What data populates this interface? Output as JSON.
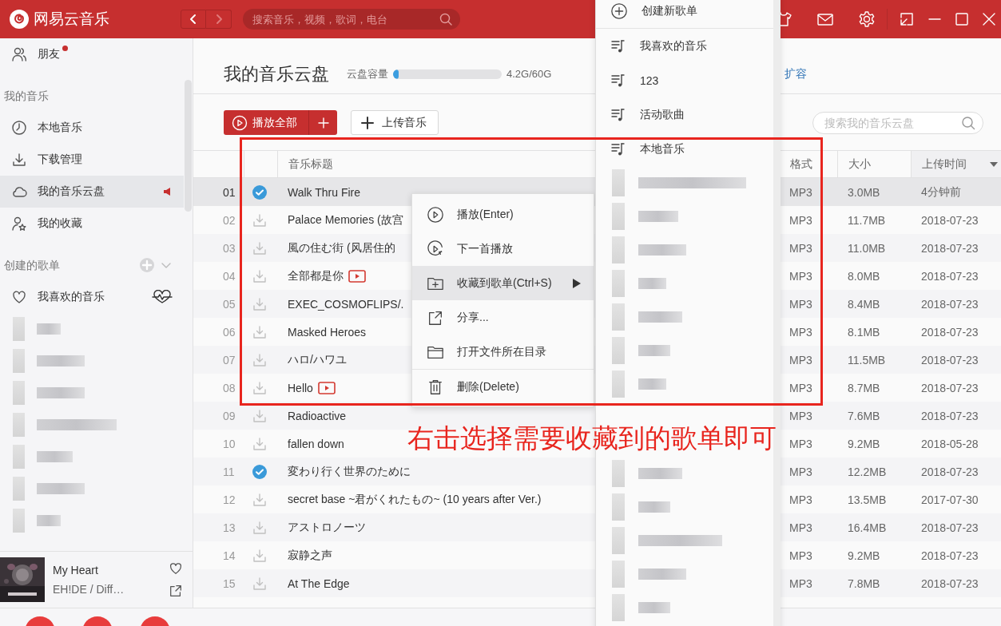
{
  "app": {
    "name": "网易云音乐"
  },
  "search": {
    "placeholder": "搜索音乐，视频，歌词，电台"
  },
  "sidebar": {
    "items": [
      {
        "kind": "item",
        "label": "朋友",
        "notify": true,
        "selected": false,
        "playing": false
      },
      {
        "kind": "section",
        "label": "我的音乐"
      },
      {
        "kind": "item",
        "label": "本地音乐",
        "notify": false,
        "selected": false,
        "playing": false
      },
      {
        "kind": "item",
        "label": "下载管理",
        "notify": false,
        "selected": false,
        "playing": false
      },
      {
        "kind": "item",
        "label": "我的音乐云盘",
        "notify": false,
        "selected": true,
        "playing": true
      },
      {
        "kind": "item",
        "label": "我的收藏",
        "notify": false,
        "selected": false,
        "playing": false
      },
      {
        "kind": "playlist_header",
        "label": "创建的歌单"
      },
      {
        "kind": "favorite",
        "label": "我喜欢的音乐",
        "notify": false,
        "selected": false,
        "playing": false
      },
      {
        "kind": "blurred"
      },
      {
        "kind": "blurred"
      },
      {
        "kind": "blurred"
      },
      {
        "kind": "blurred"
      },
      {
        "kind": "blurred"
      },
      {
        "kind": "blurred"
      },
      {
        "kind": "blurred"
      }
    ]
  },
  "player": {
    "title": "My Heart",
    "artist": "EH!DE / Diff…",
    "liked": false
  },
  "page": {
    "title": "我的音乐云盘",
    "capacity_label": "云盘容量",
    "capacity": {
      "level": 0.05
    },
    "capacity_text": "4.2G/60G",
    "expand_link": "扩容"
  },
  "toolbar": {
    "play_all": "播放全部",
    "upload": "上传音乐",
    "search_placeholder": "搜索我的音乐云盘"
  },
  "table": {
    "columns": [
      {
        "kind": "index"
      },
      {
        "kind": "status"
      },
      {
        "kind": "title",
        "label": "音乐标题"
      },
      {
        "kind": "format",
        "label": "格式"
      },
      {
        "kind": "size",
        "label": "大小"
      },
      {
        "kind": "time",
        "label": "上传时间",
        "sorted": true
      }
    ],
    "rows": [
      {
        "index": "01",
        "checked": true,
        "title": "Walk Thru Fire",
        "mv": false,
        "format": "MP3",
        "size": "3.0MB",
        "time": "4分钟前",
        "selected": true
      },
      {
        "index": "02",
        "checked": false,
        "title": "Palace Memories (故宫",
        "mv": false,
        "format": "MP3",
        "size": "11.7MB",
        "time": "2018-07-23",
        "selected": false
      },
      {
        "index": "03",
        "checked": false,
        "title": "風の住む街 (风居住的",
        "mv": false,
        "format": "MP3",
        "size": "11.0MB",
        "time": "2018-07-23",
        "selected": false
      },
      {
        "index": "04",
        "checked": false,
        "title": "全部都是你",
        "mv": true,
        "format": "MP3",
        "size": "8.0MB",
        "time": "2018-07-23",
        "selected": false
      },
      {
        "index": "05",
        "checked": false,
        "title": "EXEC_COSMOFLIPS/.",
        "mv": false,
        "format": "MP3",
        "size": "8.4MB",
        "time": "2018-07-23",
        "selected": false
      },
      {
        "index": "06",
        "checked": false,
        "title": "Masked Heroes",
        "mv": false,
        "format": "MP3",
        "size": "8.1MB",
        "time": "2018-07-23",
        "selected": false
      },
      {
        "index": "07",
        "checked": false,
        "title": "ハロ/ハワユ",
        "mv": false,
        "format": "MP3",
        "size": "11.5MB",
        "time": "2018-07-23",
        "selected": false
      },
      {
        "index": "08",
        "checked": false,
        "title": "Hello",
        "mv": true,
        "format": "MP3",
        "size": "8.7MB",
        "time": "2018-07-23",
        "selected": false
      },
      {
        "index": "09",
        "checked": false,
        "title": "Radioactive",
        "mv": false,
        "format": "MP3",
        "size": "7.6MB",
        "time": "2018-07-23",
        "selected": false
      },
      {
        "index": "10",
        "checked": false,
        "title": "fallen down",
        "mv": false,
        "format": "MP3",
        "size": "9.2MB",
        "time": "2018-05-28",
        "selected": false
      },
      {
        "index": "11",
        "checked": true,
        "title": "変わり行く世界のために",
        "mv": false,
        "format": "MP3",
        "size": "12.2MB",
        "time": "2018-07-23",
        "selected": false
      },
      {
        "index": "12",
        "checked": false,
        "title": "secret base ~君がくれたもの~ (10 years after Ver.)",
        "mv": false,
        "format": "MP3",
        "size": "13.5MB",
        "time": "2017-07-30",
        "selected": false
      },
      {
        "index": "13",
        "checked": false,
        "title": "アストロノーツ",
        "mv": false,
        "format": "MP3",
        "size": "16.4MB",
        "time": "2018-07-23",
        "selected": false
      },
      {
        "index": "14",
        "checked": false,
        "title": "寂静之声",
        "mv": false,
        "format": "MP3",
        "size": "9.2MB",
        "time": "2018-07-23",
        "selected": false
      },
      {
        "index": "15",
        "checked": false,
        "title": "At The Edge",
        "mv": false,
        "format": "MP3",
        "size": "7.8MB",
        "time": "2018-07-23",
        "selected": false
      }
    ]
  },
  "context_menu": {
    "items": [
      {
        "kind": "item",
        "label": "播放(Enter)",
        "highlighted": false,
        "submenu": false
      },
      {
        "kind": "item",
        "label": "下一首播放",
        "highlighted": false,
        "submenu": false
      },
      {
        "kind": "item",
        "label": "收藏到歌单(Ctrl+S)",
        "highlighted": true,
        "submenu": true
      },
      {
        "kind": "item",
        "label": "分享...",
        "highlighted": false,
        "submenu": false
      },
      {
        "kind": "item",
        "label": "打开文件所在目录",
        "highlighted": false,
        "submenu": false
      },
      {
        "kind": "divider"
      },
      {
        "kind": "item",
        "label": "删除(Delete)",
        "highlighted": false,
        "submenu": false
      }
    ]
  },
  "submenu": {
    "items": [
      {
        "kind": "create",
        "label": "创建新歌单"
      },
      {
        "kind": "playlist",
        "label": "我喜欢的音乐"
      },
      {
        "kind": "playlist",
        "label": "123"
      },
      {
        "kind": "playlist",
        "label": "活动歌曲"
      },
      {
        "kind": "playlist",
        "label": "本地音乐"
      },
      {
        "kind": "blurred"
      },
      {
        "kind": "blurred"
      },
      {
        "kind": "blurred"
      },
      {
        "kind": "blurred"
      },
      {
        "kind": "blurred"
      },
      {
        "kind": "blurred"
      },
      {
        "kind": "blurred"
      },
      {
        "kind": "blurred"
      },
      {
        "kind": "blurred"
      },
      {
        "kind": "blurred"
      },
      {
        "kind": "blurred"
      },
      {
        "kind": "blurred"
      }
    ]
  },
  "annotation": {
    "text": "右击选择需要收藏到的歌单即可"
  }
}
